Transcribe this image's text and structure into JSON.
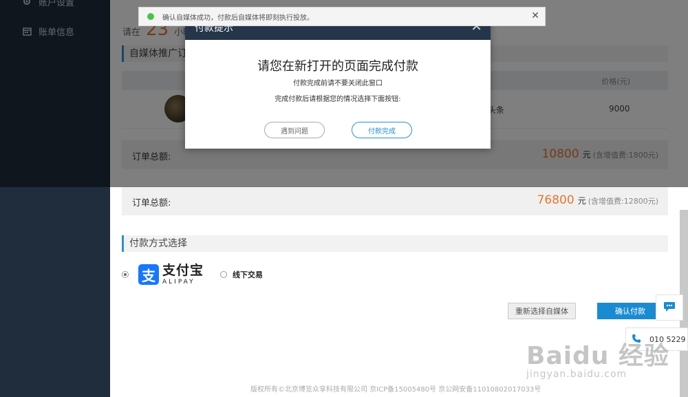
{
  "sidebar": {
    "items": [
      {
        "label": "账户设置",
        "icon": "gear-icon"
      },
      {
        "label": "账单信息",
        "icon": "calendar-icon"
      }
    ]
  },
  "timer": {
    "prefix": "请在",
    "value": "23",
    "suffix": "小时"
  },
  "section_promo": {
    "title": "自媒体推广订"
  },
  "table": {
    "price_header": "价格(元)",
    "row": {
      "text": "头条",
      "price": "9000"
    }
  },
  "order_total_1": {
    "label": "订单总额:",
    "amount": "10800",
    "unit": "元",
    "tax": "(含增值费:1800元)"
  },
  "order_total_2": {
    "label": "订单总额:",
    "amount": "76800",
    "unit": "元",
    "tax": "(含增值费:12800元)"
  },
  "payment": {
    "title": "付款方式选择",
    "alipay_cn": "支付宝",
    "alipay_en": "ALIPAY",
    "alipay_glyph": "支",
    "offline_label": "线下交易"
  },
  "buttons": {
    "reselect": "重新选择自媒体",
    "confirm": "确认付款"
  },
  "footer": {
    "text": "版权所有©北京博览众享科技有限公司 京ICP备15005480号 京公网安备11010802017033号"
  },
  "contact": {
    "phone": "010 5229"
  },
  "modal": {
    "title": "付款提示",
    "heading": "请您在新打开的页面完成付款",
    "line1": "付款完成前请不要关闭此窗口",
    "line2": "完成付款后请根据您的情况选择下面按钮:",
    "btn_problem": "遇到问题",
    "btn_done": "付款完成",
    "close": "✕"
  },
  "toast": {
    "message": "确认自媒体成功，付款后自媒体将即刻执行投放。",
    "close": "✕"
  },
  "watermark": {
    "brand": "Baidu 经验",
    "url": "jingyan.baidu.com"
  },
  "colors": {
    "sidebar": "#1f2d3d",
    "accent": "#2a8fd0",
    "amount": "#e4772c",
    "confirm": "#1a8bd1",
    "alipay": "#1677ff"
  }
}
